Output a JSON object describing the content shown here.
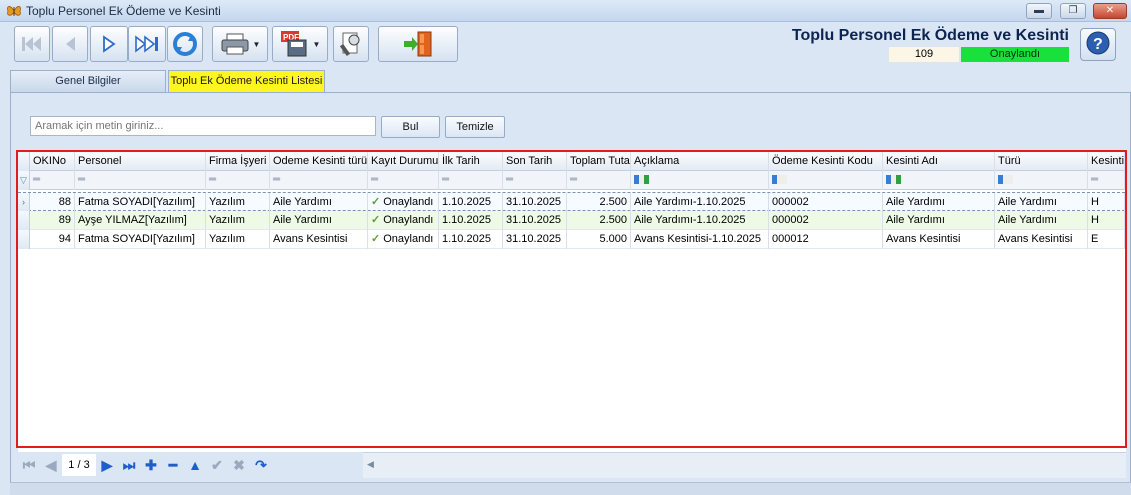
{
  "window": {
    "title": "Toplu Personel Ek Ödeme ve Kesinti",
    "minimize": "▬",
    "maximize": "❐",
    "close": "✕"
  },
  "header": {
    "title": "Toplu Personel Ek Ödeme ve Kesinti",
    "doc_no": "109",
    "status": "Onaylandı",
    "status_color": "#17e13a"
  },
  "toolbar": {
    "icons": [
      "first-record-icon",
      "previous-record-icon",
      "next-record-icon",
      "last-record-icon",
      "refresh-icon",
      "print-icon",
      "pdf-save-icon",
      "tools-icon",
      "exit-door-icon",
      "help-icon"
    ]
  },
  "tabs": [
    {
      "label": "Genel Bilgiler",
      "active": false
    },
    {
      "label": "Toplu Ek Ödeme Kesinti Listesi",
      "active": true
    }
  ],
  "search": {
    "placeholder": "Aramak için metin giriniz...",
    "find_label": "Bul",
    "clear_label": "Temizle"
  },
  "grid": {
    "columns": [
      "OKINo",
      "Personel",
      "Firma İşyeri",
      "Odeme Kesinti türü",
      "Kayıt Durumu",
      "İlk Tarih",
      "Son Tarih",
      "Toplam Tuta",
      "Açıklama",
      "Ödeme Kesinti Kodu",
      "Kesinti Adı",
      "Türü",
      "Kesinti"
    ],
    "rows": [
      {
        "okino": "88",
        "personel": "Fatma SOYADI[Yazılım]",
        "firma": "Yazılım",
        "tur": "Aile Yardımı",
        "durum": "Onaylandı",
        "ilk": "1.10.2025",
        "son": "31.10.2025",
        "tutar": "2.500",
        "aciklama": "Aile Yardımı-1.10.2025",
        "kod": "000002",
        "ad": "Aile Yardımı",
        "turu": "Aile Yardımı",
        "kesinti": "H"
      },
      {
        "okino": "89",
        "personel": "Ayşe YILMAZ[Yazılım]",
        "firma": "Yazılım",
        "tur": "Aile Yardımı",
        "durum": "Onaylandı",
        "ilk": "1.10.2025",
        "son": "31.10.2025",
        "tutar": "2.500",
        "aciklama": "Aile Yardımı-1.10.2025",
        "kod": "000002",
        "ad": "Aile Yardımı",
        "turu": "Aile Yardımı",
        "kesinti": "H"
      },
      {
        "okino": "94",
        "personel": "Fatma SOYADI[Yazılım]",
        "firma": "Yazılım",
        "tur": "Avans Kesintisi",
        "durum": "Onaylandı",
        "ilk": "1.10.2025",
        "son": "31.10.2025",
        "tutar": "5.000",
        "aciklama": "Avans Kesintisi-1.10.2025",
        "kod": "000012",
        "ad": "Avans Kesintisi",
        "turu": "Avans Kesintisi",
        "kesinti": "E"
      }
    ]
  },
  "navigator": {
    "page": "1 / 3"
  }
}
